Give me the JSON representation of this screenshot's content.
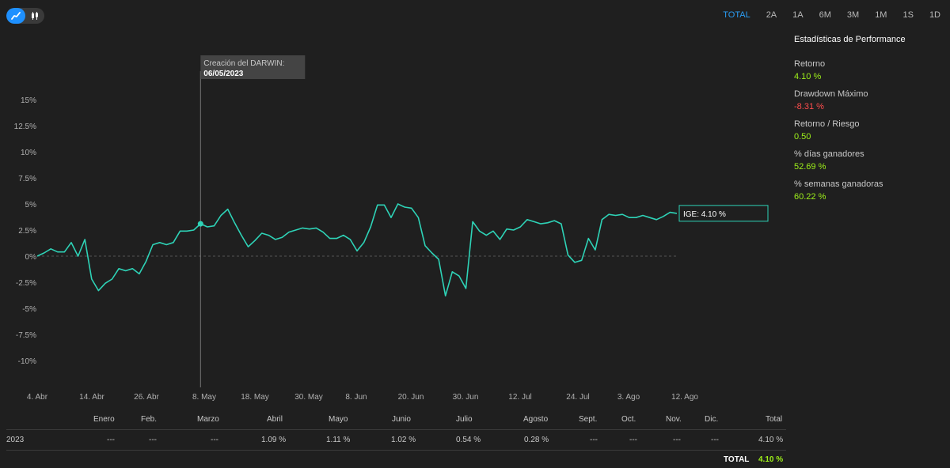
{
  "toolbar": {
    "chart_mode": [
      "line-chart-icon",
      "candlestick-icon"
    ],
    "periods": [
      "TOTAL",
      "2A",
      "1A",
      "6M",
      "3M",
      "1M",
      "1S",
      "1D"
    ],
    "active_period": "TOTAL"
  },
  "tooltip": {
    "label": "Creación del DARWIN:",
    "date": "06/05/2023"
  },
  "ige_label": "IGE: 4.10 %",
  "stats": {
    "title": "Estadísticas de Performance",
    "items": [
      {
        "label": "Retorno",
        "value": "4.10 %",
        "tone": "pos"
      },
      {
        "label": "Drawdown Máximo",
        "value": "-8.31 %",
        "tone": "neg"
      },
      {
        "label": "Retorno / Riesgo",
        "value": "0.50",
        "tone": "pos"
      },
      {
        "label": "% días ganadores",
        "value": "52.69 %",
        "tone": "pos"
      },
      {
        "label": "% semanas ganadoras",
        "value": "60.22 %",
        "tone": "pos"
      }
    ]
  },
  "monthly": {
    "headers": [
      "Enero",
      "Feb.",
      "Marzo",
      "Abril",
      "Mayo",
      "Junio",
      "Julio",
      "Agosto",
      "Sept.",
      "Oct.",
      "Nov.",
      "Dic.",
      "Total"
    ],
    "year": "2023",
    "values": [
      "---",
      "---",
      "---",
      "1.09 %",
      "1.11 %",
      "1.02 %",
      "0.54 %",
      "0.28 %",
      "---",
      "---",
      "---",
      "---",
      "4.10 %"
    ],
    "total_label": "TOTAL",
    "total_value": "4.10 %"
  },
  "colors": {
    "line": "#2ed3b7",
    "positive": "#9ef01a",
    "negative": "#ff4d4d",
    "accent": "#2a9df4"
  },
  "chart_data": {
    "type": "line",
    "x_tick_labels": [
      "4. Abr",
      "14. Abr",
      "26. Abr",
      "8. May",
      "18. May",
      "30. May",
      "8. Jun",
      "20. Jun",
      "30. Jun",
      "12. Jul",
      "24. Jul",
      "3. Ago",
      "12. Ago"
    ],
    "y_tick_labels": [
      "15%",
      "12.5%",
      "10%",
      "7.5%",
      "5%",
      "2.5%",
      "0%",
      "-2.5%",
      "-5%",
      "-7.5%",
      "-10%"
    ],
    "ylim": [
      -12.5,
      15
    ],
    "marker_date": "06/05/2023",
    "series": [
      {
        "values": [
          0,
          0.3,
          0.7,
          0.4,
          0.4,
          1.3,
          0,
          1.6,
          -2.2,
          -3.3,
          -2.6,
          -2.2,
          -1.2,
          -1.4,
          -1.2,
          -1.7,
          -0.5,
          1.1,
          1.3,
          1.1,
          1.3,
          2.4,
          2.4,
          2.5,
          3.1,
          2.8,
          2.9,
          3.9,
          4.5,
          3.2,
          2.0,
          0.9,
          1.5,
          2.2,
          2.0,
          1.6,
          1.8,
          2.3,
          2.5,
          2.7,
          2.6,
          2.7,
          2.3,
          1.7,
          1.7,
          2.0,
          1.6,
          0.5,
          1.3,
          2.8,
          4.9,
          4.9,
          3.7,
          5.0,
          4.7,
          4.6,
          3.7,
          1.0,
          0.3,
          -0.3,
          -3.8,
          -1.5,
          -1.9,
          -3.1,
          3.3,
          2.4,
          2.0,
          2.4,
          1.6,
          2.6,
          2.5,
          2.8,
          3.5,
          3.3,
          3.1,
          3.2,
          3.4,
          3.1,
          0.1,
          -0.6,
          -0.4,
          1.7,
          0.6,
          3.5,
          4.0,
          3.9,
          4.0,
          3.7,
          3.7,
          3.9,
          3.7,
          3.5,
          3.8,
          4.2,
          4.1
        ]
      }
    ]
  }
}
